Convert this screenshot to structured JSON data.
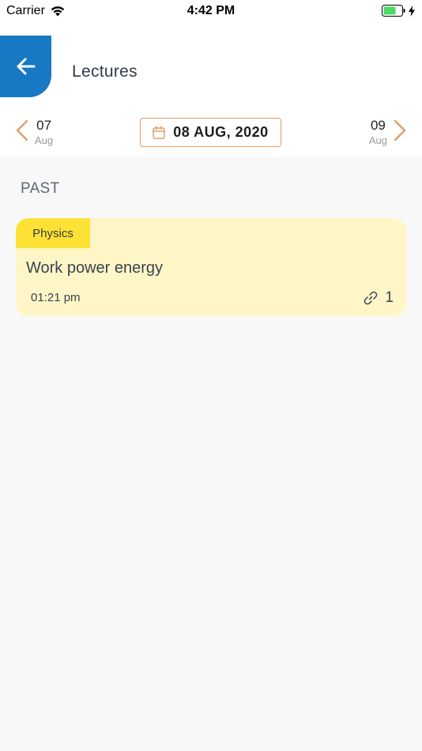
{
  "status_bar": {
    "carrier": "Carrier",
    "time": "4:42 PM"
  },
  "header": {
    "title": "Lectures",
    "accent_color": "#1778c4"
  },
  "date_nav": {
    "prev": {
      "day": "07",
      "month": "Aug"
    },
    "current": "08 AUG, 2020",
    "next": {
      "day": "09",
      "month": "Aug"
    },
    "accent_color": "#e0a06b"
  },
  "section": {
    "title": "PAST"
  },
  "lectures": [
    {
      "subject": "Physics",
      "title": "Work power energy",
      "time": "01:21 pm",
      "attachments": "1",
      "card_color": "#fef6c6",
      "tag_color": "#fde235"
    }
  ]
}
